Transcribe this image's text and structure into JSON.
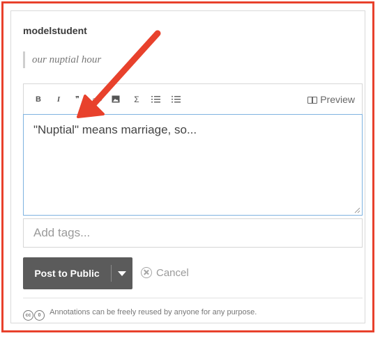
{
  "username": "modelstudent",
  "quote": "our nuptial hour",
  "toolbar": {
    "bold": "B",
    "italic": "I",
    "quote": "❞",
    "link": "⊂⊃",
    "image": "▣",
    "math": "Σ",
    "numbered_list": "≡",
    "bullet_list": "≡",
    "preview_label": "Preview"
  },
  "editor": {
    "value": "\"Nuptial\" means marriage, so..."
  },
  "tags": {
    "placeholder": "Add tags..."
  },
  "actions": {
    "post_label": "Post to Public",
    "cancel_label": "Cancel"
  },
  "license": {
    "text": "Annotations can be freely reused by anyone for any purpose.",
    "cc": "cc",
    "zero": "0"
  },
  "colors": {
    "frame": "#e8412c",
    "arrow": "#e8412c",
    "post_button": "#5b5b5b",
    "focus_border": "#7eb2e0"
  }
}
